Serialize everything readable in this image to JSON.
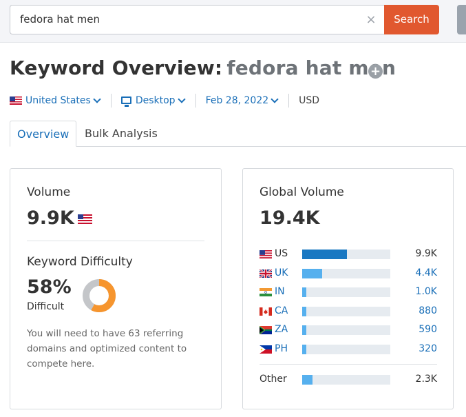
{
  "search": {
    "value": "fedora hat men",
    "clear_glyph": "×",
    "button_label": "Search"
  },
  "header": {
    "title": "Keyword Overview:",
    "keyword": "fedora hat men",
    "add_glyph": "+"
  },
  "filters": {
    "country": "United States",
    "device": "Desktop",
    "date": "Feb 28, 2022",
    "currency": "USD"
  },
  "tabs": [
    {
      "label": "Overview",
      "active": true
    },
    {
      "label": "Bulk Analysis",
      "active": false
    }
  ],
  "volume": {
    "heading": "Volume",
    "value": "9.9K"
  },
  "keyword_difficulty": {
    "heading": "Keyword Difficulty",
    "percent_label": "58%",
    "percent": 58,
    "level": "Difficult",
    "description": "You will need to have 63 referring domains and optimized content to compete here."
  },
  "global_volume": {
    "heading": "Global Volume",
    "value": "19.4K",
    "countries": [
      {
        "code": "US",
        "value": "9.9K",
        "fraction": 0.51,
        "link": false
      },
      {
        "code": "UK",
        "value": "4.4K",
        "fraction": 0.23,
        "link": true
      },
      {
        "code": "IN",
        "value": "1.0K",
        "fraction": 0.05,
        "link": true
      },
      {
        "code": "CA",
        "value": "880",
        "fraction": 0.045,
        "link": true
      },
      {
        "code": "ZA",
        "value": "590",
        "fraction": 0.03,
        "link": true
      },
      {
        "code": "PH",
        "value": "320",
        "fraction": 0.017,
        "link": true
      }
    ],
    "other": {
      "label": "Other",
      "value": "2.3K",
      "fraction": 0.12
    }
  },
  "colors": {
    "accent": "#e1582f",
    "link": "#1a6fb8",
    "bar_primary": "#1a78c2",
    "bar_secondary": "#56b0ee",
    "bar_track": "#e6ebf0",
    "difficulty": "#f6952e",
    "difficulty_track": "#c4c6c9"
  }
}
